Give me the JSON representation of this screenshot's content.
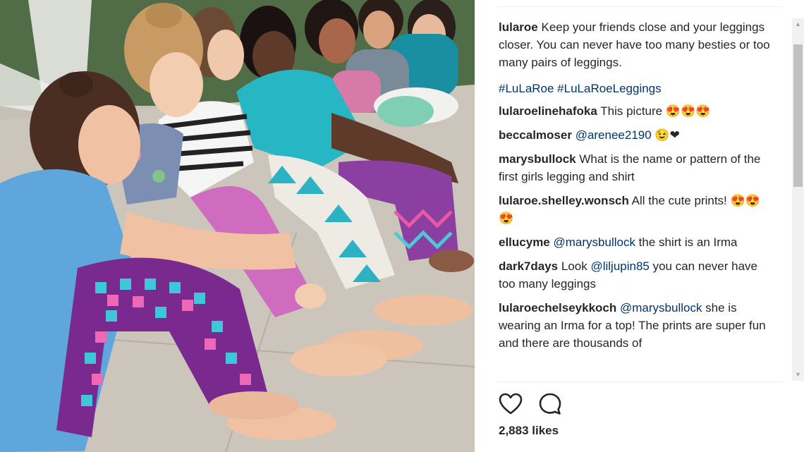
{
  "post": {
    "caption": {
      "username": "lularoe",
      "text": "Keep your friends close and your leggings closer. You can never have too many besties or too many pairs of leggings.",
      "hashtags": "#LuLaRoe #LuLaRoeLeggings"
    },
    "comments": [
      {
        "username": "lularoelinehafoka",
        "parts": [
          {
            "type": "text",
            "value": "This picture 😍😍😍"
          }
        ]
      },
      {
        "username": "beccalmoser",
        "parts": [
          {
            "type": "mention",
            "value": "@arenee2190"
          },
          {
            "type": "text",
            "value": " 😉❤"
          }
        ]
      },
      {
        "username": "marysbullock",
        "parts": [
          {
            "type": "text",
            "value": "What is the name or pattern of the first girls legging and shirt"
          }
        ]
      },
      {
        "username": "lularoe.shelley.wonsch",
        "parts": [
          {
            "type": "text",
            "value": "All the cute prints! 😍😍😍"
          }
        ]
      },
      {
        "username": "ellucyme",
        "parts": [
          {
            "type": "mention",
            "value": "@marysbullock"
          },
          {
            "type": "text",
            "value": " the shirt is an Irma"
          }
        ]
      },
      {
        "username": "dark7days",
        "parts": [
          {
            "type": "text",
            "value": "Look "
          },
          {
            "type": "mention",
            "value": "@liljupin85"
          },
          {
            "type": "text",
            "value": " you can never have too many leggings"
          }
        ]
      },
      {
        "username": "lularoechelseykkoch",
        "parts": [
          {
            "type": "mention",
            "value": "@marysbullock"
          },
          {
            "type": "text",
            "value": " she is wearing an Irma for a top! The prints are super fun and there are thousands of"
          }
        ]
      }
    ],
    "likes": "2,883 likes",
    "timestamp": "",
    "icons": {
      "like": "heart-icon",
      "comment": "speech-bubble-icon"
    }
  },
  "colors": {
    "username": "#262626",
    "mention": "#003569",
    "text": "#262626",
    "muted": "#999999"
  }
}
